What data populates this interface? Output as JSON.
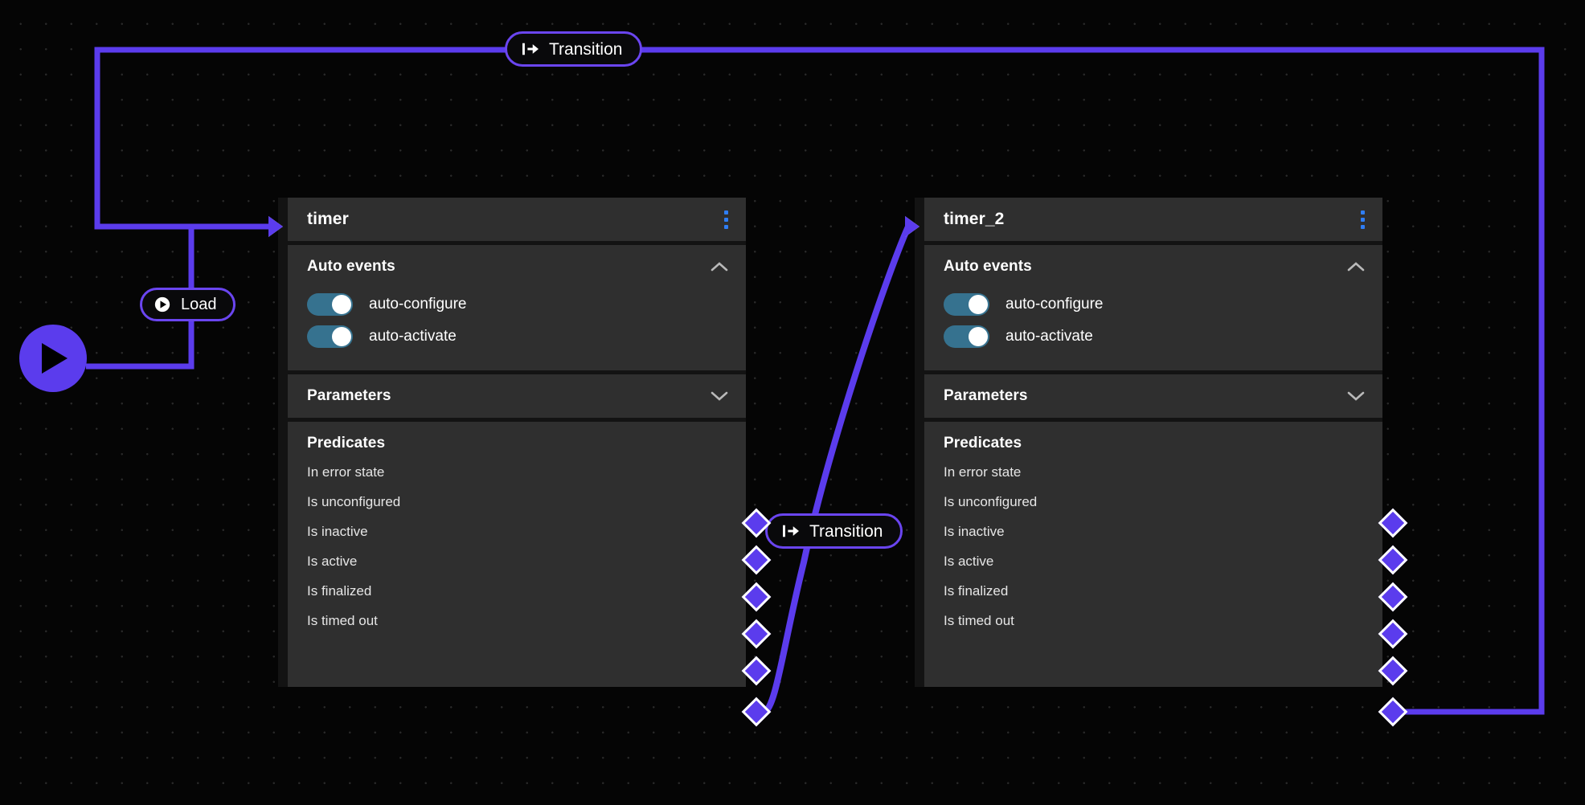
{
  "canvas": {
    "grid": "dot-grid",
    "background_color": "#050505",
    "accent_color": "#5b3ced",
    "toggle_on_color": "#36728f",
    "kebab_color": "#2f7ef5",
    "panel_color": "#2f2f2f"
  },
  "start_button": {
    "name": "run-workflow",
    "icon": "play-icon"
  },
  "badges": {
    "load": {
      "label": "Load",
      "icon": "play-circle-icon"
    },
    "transition_top": {
      "label": "Transition",
      "icon": "transition-arrow-icon"
    },
    "transition_mid": {
      "label": "Transition",
      "icon": "transition-arrow-icon"
    }
  },
  "section_labels": {
    "auto_events": "Auto events",
    "parameters": "Parameters",
    "predicates": "Predicates"
  },
  "toggles": [
    {
      "label": "auto-configure",
      "on": true
    },
    {
      "label": "auto-activate",
      "on": true
    }
  ],
  "predicates": [
    "In error state",
    "Is unconfigured",
    "Is inactive",
    "Is active",
    "Is finalized",
    "Is timed out"
  ],
  "nodes": [
    {
      "id": "timer",
      "title": "timer",
      "auto_events_expanded": true,
      "parameters_expanded": false,
      "predicates_expanded": true
    },
    {
      "id": "timer_2",
      "title": "timer_2",
      "auto_events_expanded": true,
      "parameters_expanded": false,
      "predicates_expanded": true
    }
  ]
}
